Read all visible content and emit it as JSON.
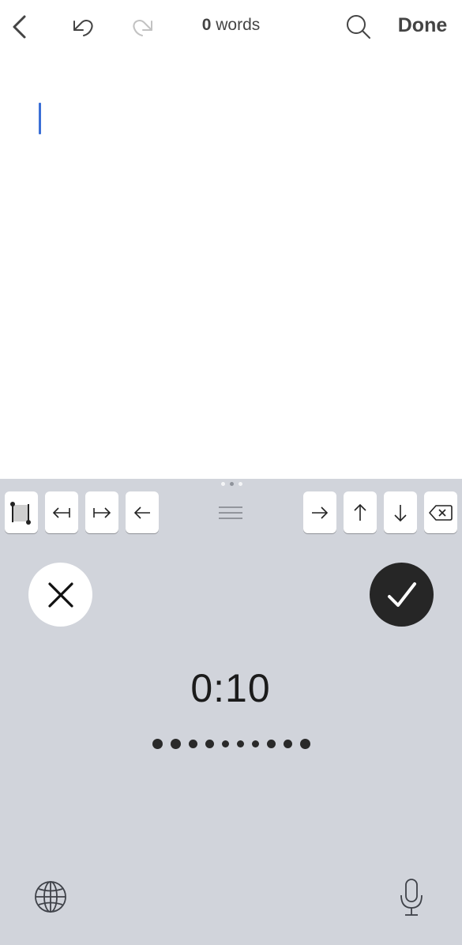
{
  "toolbar": {
    "word_count_number": "0",
    "word_count_label": "words",
    "done_label": "Done"
  },
  "document": {
    "text": ""
  },
  "keyboard_toolbar": {
    "keys": [
      "select-text-icon",
      "move-to-line-start-icon",
      "move-to-line-end-icon",
      "arrow-left-icon",
      "arrow-right-icon",
      "arrow-up-icon",
      "arrow-down-icon",
      "delete-icon"
    ],
    "page_indicator": {
      "count": 3,
      "active_index": 1
    }
  },
  "dictation": {
    "timer": "0:10",
    "levels": [
      3,
      3,
      2,
      2,
      1,
      1,
      1,
      2,
      2,
      3
    ]
  },
  "colors": {
    "keyboard_bg": "#d1d4db",
    "caret": "#3b6fd6",
    "confirm_bg": "#262626"
  }
}
